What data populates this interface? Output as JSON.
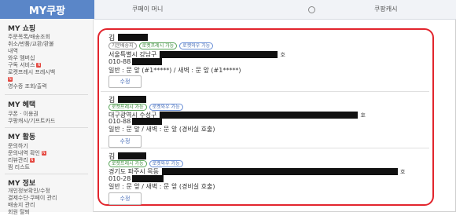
{
  "header": {
    "brand": "MY쿠팡",
    "tabs": [
      "쿠페이 머니",
      "쿠팡캐시"
    ]
  },
  "sidebar": {
    "sections": [
      {
        "title": "MY 쇼핑",
        "items": [
          {
            "label": "주문목록/배송조회",
            "badge": ""
          },
          {
            "label": "취소/반품/교환/환불",
            "badge": ""
          },
          {
            "label": "내역",
            "badge": ""
          },
          {
            "label": "와우 멤버십",
            "badge": ""
          },
          {
            "label": "구독 서비스",
            "badge": "N"
          },
          {
            "label": "로켓프레시 프레시백",
            "badge": ""
          },
          {
            "label": "",
            "badge": "N"
          },
          {
            "label": "영수증 조회/출력",
            "badge": ""
          }
        ]
      },
      {
        "title": "MY 혜택",
        "items": [
          {
            "label": "쿠폰 · 이용권",
            "badge": ""
          },
          {
            "label": "쿠팡캐시/기프트카드",
            "badge": ""
          }
        ]
      },
      {
        "title": "MY 활동",
        "items": [
          {
            "label": "문의하기",
            "badge": ""
          },
          {
            "label": "문의내역 확인",
            "badge": "N"
          },
          {
            "label": "리뷰관리",
            "badge": "N"
          },
          {
            "label": "찜 리스트",
            "badge": ""
          }
        ]
      },
      {
        "title": "MY 정보",
        "items": [
          {
            "label": "개인정보확인/수정",
            "badge": ""
          },
          {
            "label": "결제수단·쿠페이 관리",
            "badge": ""
          },
          {
            "label": "배송지 관리",
            "badge": ""
          },
          {
            "label": "회원 탈퇴",
            "badge": ""
          }
        ]
      }
    ]
  },
  "addresses": [
    {
      "name": "김",
      "badges": [
        "기본배송지",
        "로켓프레시 가능",
        "로켓와우 가능"
      ],
      "address": "서울특별시 강남구",
      "address_suffix": "호",
      "phone": "010-88",
      "entry_info": "일반 : 문 앞 (#1*****) / 새벽 : 문 앞 (#1*****)",
      "edit_label": "수정"
    },
    {
      "name": "김",
      "badges": [
        "로켓프레시 가능",
        "로켓와우 가능"
      ],
      "address": "대구광역시 수성구",
      "address_suffix": "호",
      "phone": "010-88",
      "entry_info": "일반 : 문 앞 / 새벽 : 문 앞 (경비실 호출)",
      "edit_label": "수정"
    },
    {
      "name": "김",
      "badges": [
        "로켓프레시 가능",
        "로켓와우 가능"
      ],
      "address": "경기도 파주시 목동",
      "address_suffix": "호",
      "phone": "010-28",
      "entry_info": "일반 : 문 앞 / 새벽 : 문 앞 (경비실 호출)",
      "edit_label": "수정"
    }
  ],
  "colors": {
    "brand": "#5a86c8",
    "highlight": "#e2252d",
    "new_badge": "#e4473f"
  }
}
